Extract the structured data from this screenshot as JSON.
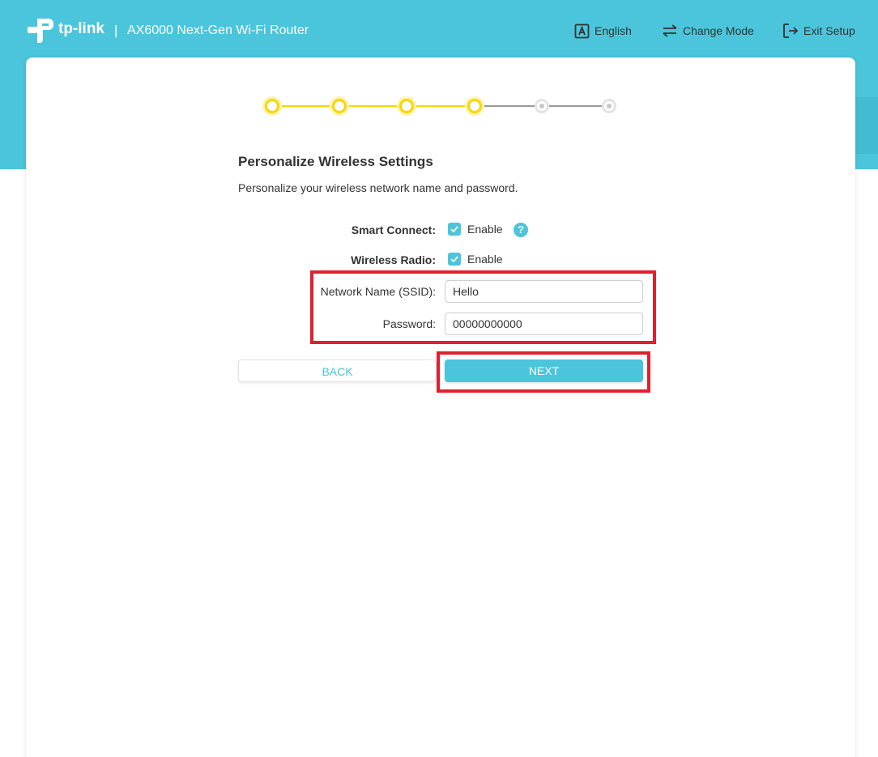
{
  "header": {
    "brand": "tp-link",
    "separator": "|",
    "product": "AX6000 Next-Gen Wi-Fi Router",
    "nav": {
      "language": "English",
      "change_mode": "Change Mode",
      "exit_setup": "Exit Setup"
    }
  },
  "stepper": {
    "total_steps": 6,
    "completed_steps": 4,
    "active_color": "#ffd400",
    "inactive_color": "#c8c8c8"
  },
  "form": {
    "title": "Personalize Wireless Settings",
    "subtitle": "Personalize your wireless network name and password.",
    "smart_connect": {
      "label": "Smart Connect:",
      "checkbox_label": "Enable",
      "checked": true
    },
    "wireless_radio": {
      "label": "Wireless Radio:",
      "checkbox_label": "Enable",
      "checked": true
    },
    "help_icon_text": "?",
    "ssid": {
      "label": "Network Name (SSID):",
      "value": "Hello"
    },
    "password": {
      "label": "Password:",
      "value": "00000000000"
    }
  },
  "buttons": {
    "back": "BACK",
    "next": "NEXT"
  },
  "colors": {
    "brand": "#4ac5dc",
    "highlight": "#e0202e"
  }
}
